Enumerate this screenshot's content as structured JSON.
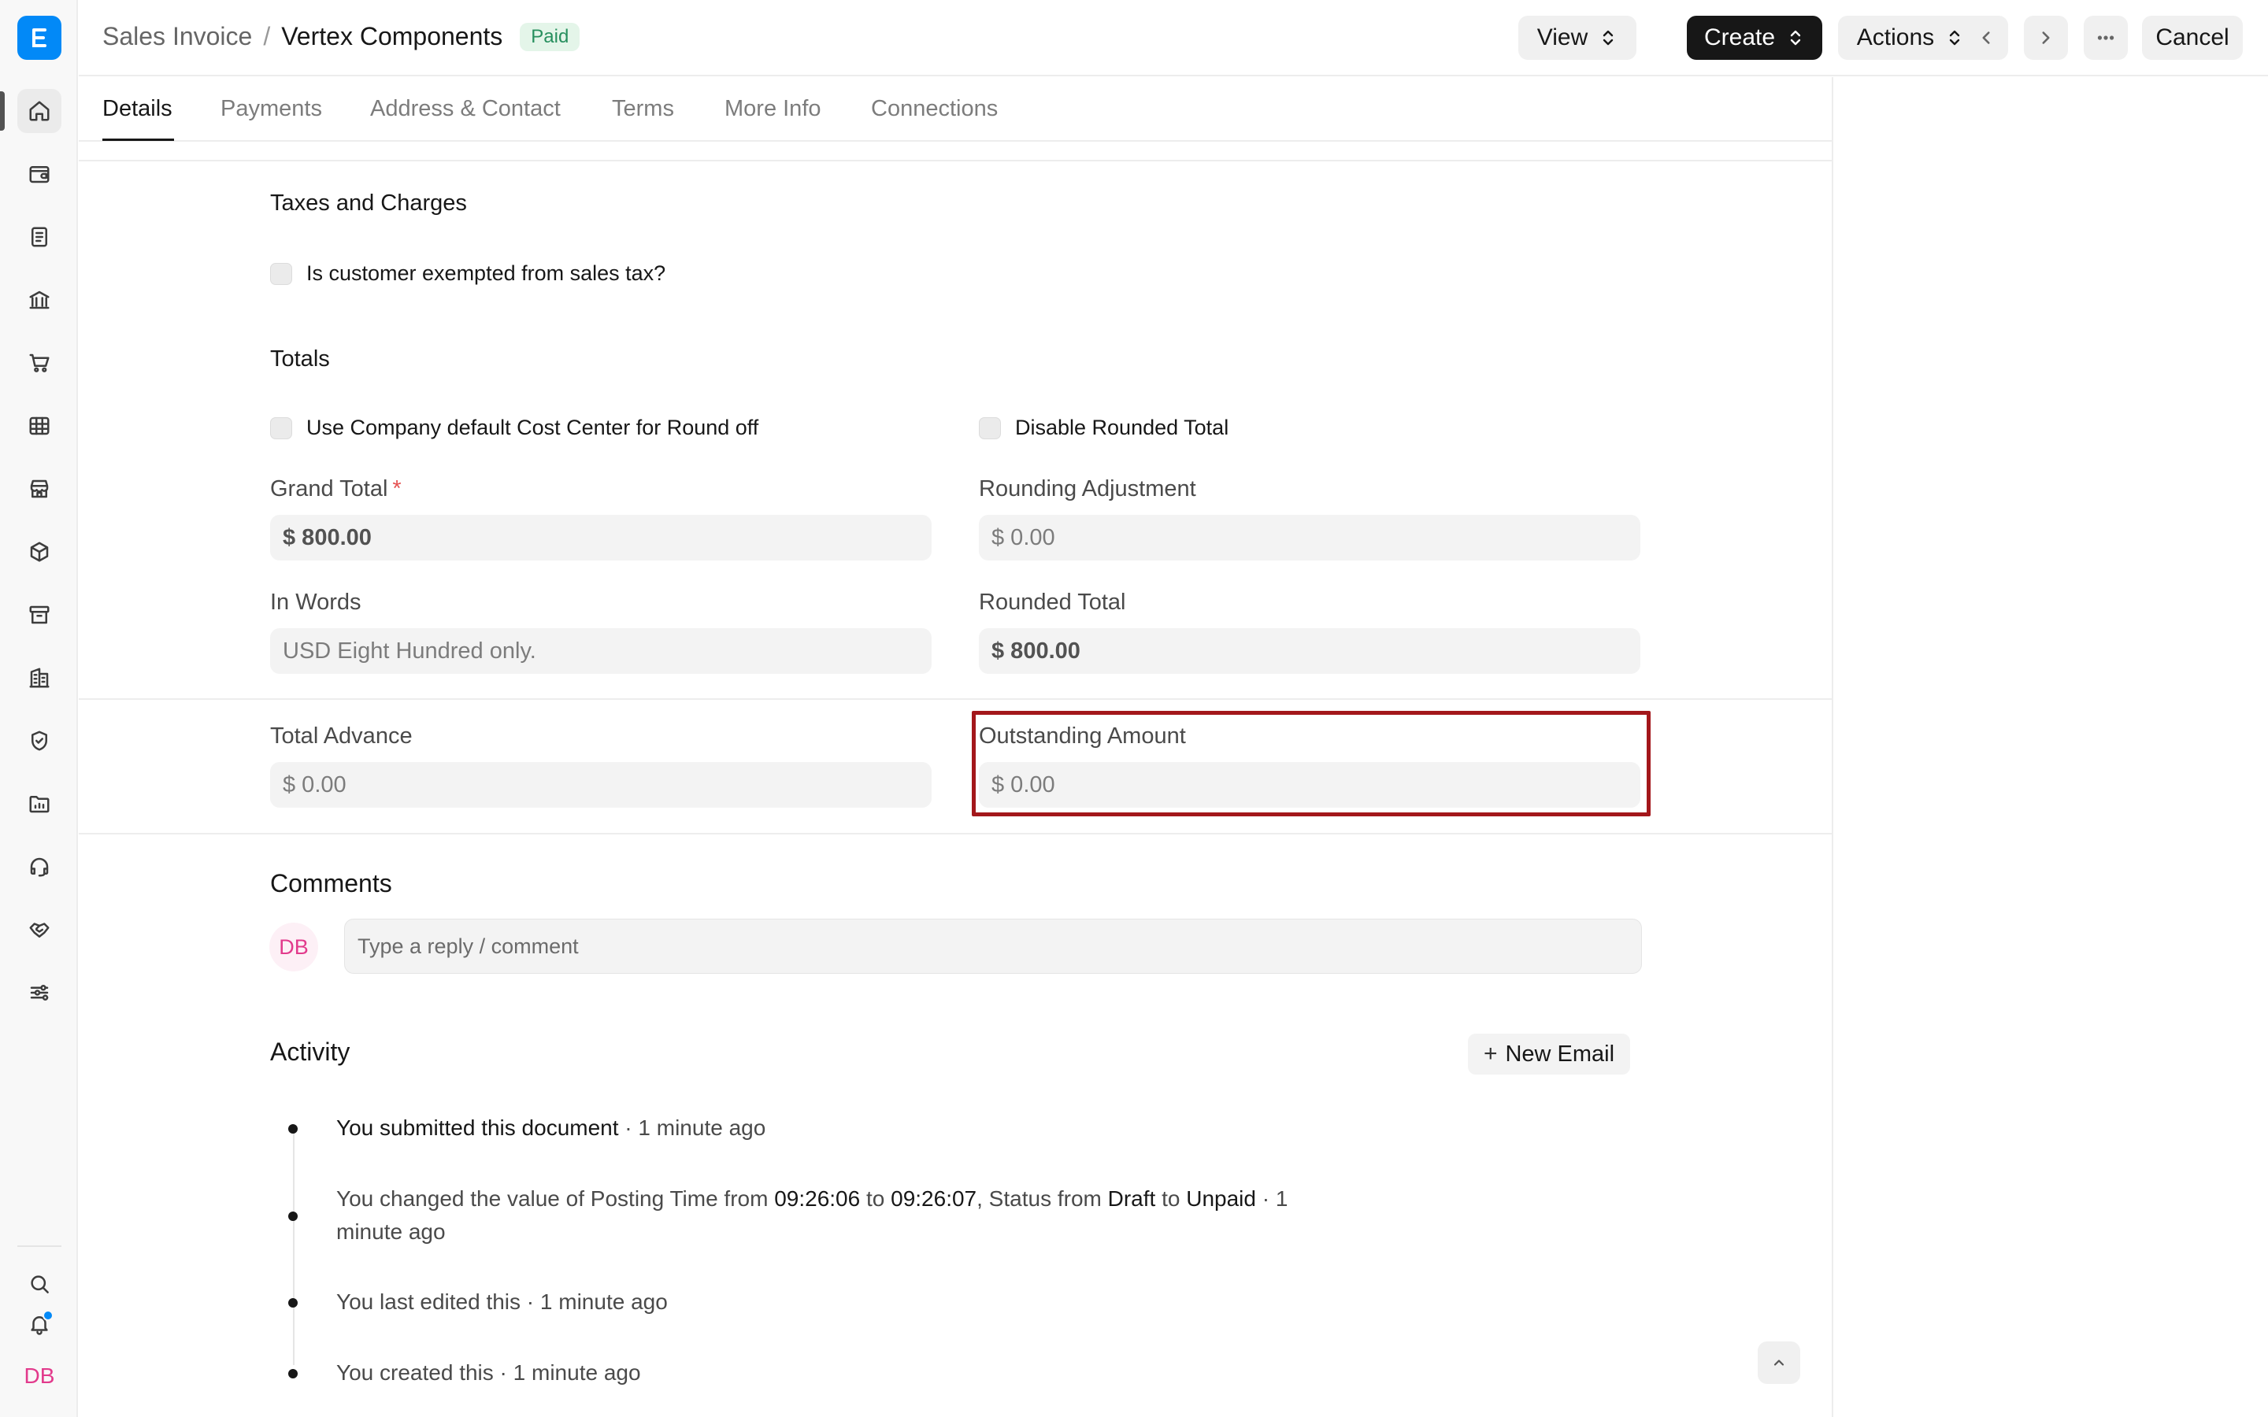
{
  "app": {
    "logo_icon": "erpnext-logo-icon",
    "brand_color": "#0289f7",
    "user_initials": "DB"
  },
  "sidebar": {
    "items": [
      {
        "icon": "home-icon",
        "active": true
      },
      {
        "icon": "wallet-icon"
      },
      {
        "icon": "document-icon"
      },
      {
        "icon": "bank-icon"
      },
      {
        "icon": "cart-icon"
      },
      {
        "icon": "table-icon"
      },
      {
        "icon": "store-icon"
      },
      {
        "icon": "package-icon"
      },
      {
        "icon": "archive-icon"
      },
      {
        "icon": "building-icon"
      },
      {
        "icon": "shield-icon"
      },
      {
        "icon": "folder-chart-icon"
      },
      {
        "icon": "headset-icon"
      },
      {
        "icon": "handshake-icon"
      },
      {
        "icon": "sliders-icon"
      }
    ],
    "bottom": [
      "search-icon",
      "bell-icon"
    ]
  },
  "header": {
    "breadcrumb_parent": "Sales Invoice",
    "breadcrumb_sep": "/",
    "title": "Vertex Components",
    "status_badge": "Paid",
    "view_label": "View",
    "create_label": "Create",
    "actions_label": "Actions",
    "cancel_label": "Cancel"
  },
  "tabs": [
    {
      "label": "Details",
      "active": true
    },
    {
      "label": "Payments"
    },
    {
      "label": "Address & Contact"
    },
    {
      "label": "Terms"
    },
    {
      "label": "More Info"
    },
    {
      "label": "Connections"
    }
  ],
  "taxes": {
    "title": "Taxes and Charges",
    "exempt_label": "Is customer exempted from sales tax?"
  },
  "totals": {
    "title": "Totals",
    "use_cost_center_label": "Use Company default Cost Center for Round off",
    "disable_rounded_label": "Disable Rounded Total",
    "grand_total_label": "Grand Total",
    "grand_total_required": "*",
    "grand_total_value": "$ 800.00",
    "rounding_adjustment_label": "Rounding Adjustment",
    "rounding_adjustment_value": "$ 0.00",
    "in_words_label": "In Words",
    "in_words_value": "USD Eight Hundred only.",
    "rounded_total_label": "Rounded Total",
    "rounded_total_value": "$ 800.00"
  },
  "advance": {
    "total_advance_label": "Total Advance",
    "total_advance_value": "$ 0.00",
    "outstanding_label": "Outstanding Amount",
    "outstanding_value": "$ 0.00"
  },
  "comments": {
    "title": "Comments",
    "avatar_initials": "DB",
    "placeholder": "Type a reply / comment"
  },
  "activity": {
    "title": "Activity",
    "new_email_label": "New Email",
    "items": [
      {
        "strong": "You submitted this document",
        "rest": " · 1 minute ago"
      },
      {
        "p1": "You changed the value of Posting Time from ",
        "s1": "09:26:06",
        "p2": " to ",
        "s2": "09:26:07",
        "p3": ", Status from ",
        "s3": "Draft",
        "p4": " to ",
        "s4": "Unpaid",
        "p5": " · 1 minute ago"
      },
      {
        "text": "You last edited this · 1 minute ago"
      },
      {
        "text": "You created this · 1 minute ago"
      }
    ]
  }
}
